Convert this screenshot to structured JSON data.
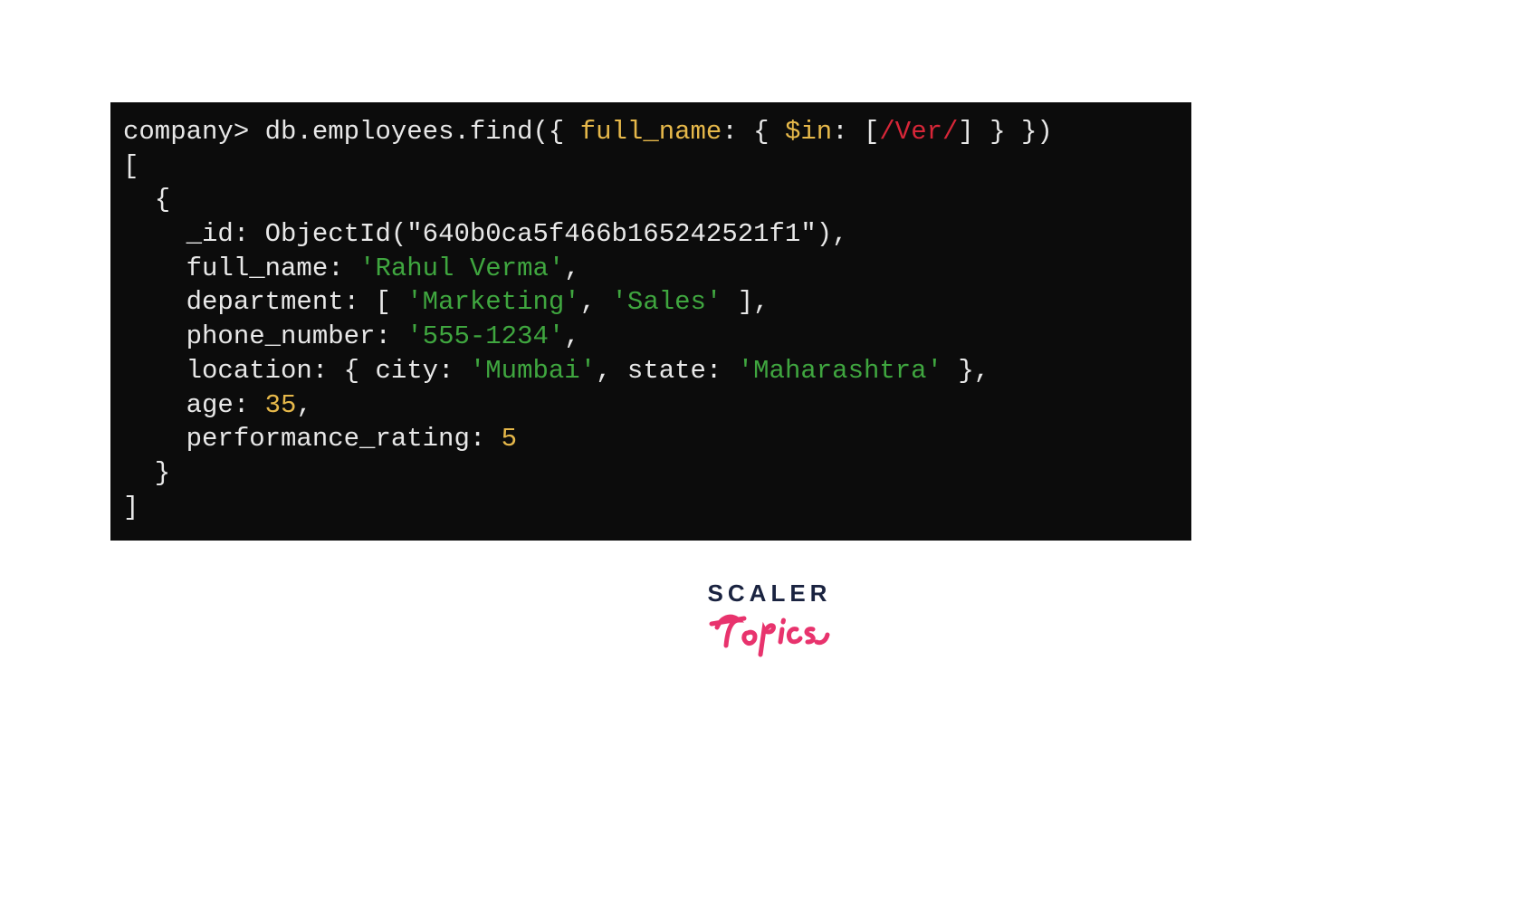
{
  "logo": {
    "line1": "SCALER",
    "line2": "Topics"
  },
  "query": {
    "prompt": "company>",
    "command_prefix": "db.employees.find({ ",
    "field": "full_name",
    "after_field": ": { ",
    "operator": "$in",
    "after_operator": ": [",
    "regex": "/Ver/",
    "command_suffix": "] } })"
  },
  "result": {
    "open_bracket": "[",
    "open_brace": "  {",
    "id_line_prefix": "    _id: ObjectId(",
    "id_value": "\"640b0ca5f466b165242521f1\"",
    "id_line_suffix": "),",
    "full_name_key": "    full_name: ",
    "full_name_val": "'Rahul Verma'",
    "full_name_suffix": ",",
    "department_key": "    department: [ ",
    "department_val1": "'Marketing'",
    "department_comma": ", ",
    "department_val2": "'Sales'",
    "department_suffix": " ],",
    "phone_key": "    phone_number: ",
    "phone_val": "'555-1234'",
    "phone_suffix": ",",
    "location_key": "    location: { city: ",
    "location_city": "'Mumbai'",
    "location_mid": ", state: ",
    "location_state": "'Maharashtra'",
    "location_suffix": " },",
    "age_key": "    age: ",
    "age_val": "35",
    "age_suffix": ",",
    "perf_key": "    performance_rating: ",
    "perf_val": "5",
    "close_brace": "  }",
    "close_bracket": "]"
  }
}
